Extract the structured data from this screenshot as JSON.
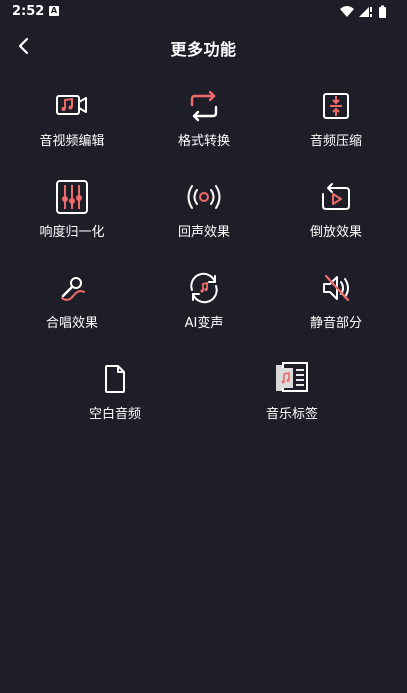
{
  "status_bar": {
    "time": "2:52",
    "notification_glyph": "A",
    "icons": [
      "wifi-icon",
      "signal-icon",
      "battery-icon"
    ]
  },
  "header": {
    "title": "更多功能",
    "back_icon": "back-arrow-icon"
  },
  "colors": {
    "background": "#1e1e29",
    "accent": "#f06a6a",
    "icon_white": "#ffffff",
    "text": "#ffffff"
  },
  "tools": {
    "av_edit": {
      "label": "音视频编辑",
      "icon": "audio-video-edit-icon"
    },
    "format_convert": {
      "label": "格式转换",
      "icon": "format-convert-icon"
    },
    "audio_compress": {
      "label": "音频压缩",
      "icon": "audio-compress-icon"
    },
    "loudness_normalize": {
      "label": "响度归一化",
      "icon": "loudness-normalize-icon"
    },
    "echo_effect": {
      "label": "回声效果",
      "icon": "echo-effect-icon"
    },
    "reverse_effect": {
      "label": "倒放效果",
      "icon": "reverse-effect-icon"
    },
    "chorus_effect": {
      "label": "合唱效果",
      "icon": "chorus-microphone-icon"
    },
    "ai_voice": {
      "label": "AI变声",
      "icon": "ai-voice-change-icon"
    },
    "mute_part": {
      "label": "静音部分",
      "icon": "mute-speaker-icon"
    },
    "blank_audio": {
      "label": "空白音频",
      "icon": "blank-file-icon"
    },
    "music_tag": {
      "label": "音乐标签",
      "icon": "music-tag-icon"
    }
  }
}
